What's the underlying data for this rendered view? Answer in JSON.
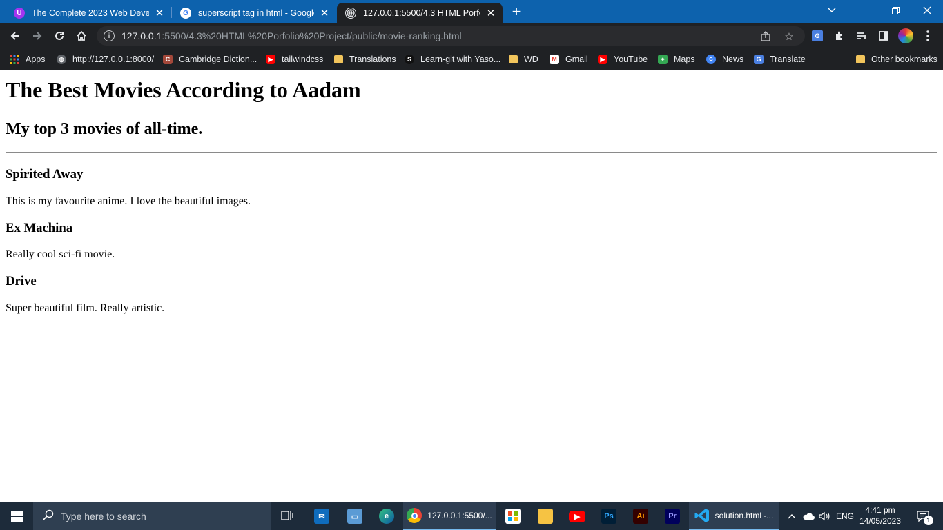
{
  "browser": {
    "tabs": [
      {
        "title": "The Complete 2023 Web Develop",
        "favicon": "udemy-icon"
      },
      {
        "title": "superscript tag in html - Google",
        "favicon": "google-icon"
      },
      {
        "title": "127.0.0.1:5500/4.3 HTML Porfolio",
        "favicon": "globe-icon"
      }
    ],
    "url_host": "127.0.0.1",
    "url_path": ":5500/4.3%20HTML%20Porfolio%20Project/public/movie-ranking.html",
    "bookmarks": [
      {
        "label": "Apps",
        "icon": "apps-grid-icon"
      },
      {
        "label": "http://127.0.0.1:8000/",
        "icon": "globe-icon"
      },
      {
        "label": "Cambridge Diction...",
        "icon": "cambridge-icon"
      },
      {
        "label": "tailwindcss",
        "icon": "youtube-icon"
      },
      {
        "label": "Translations",
        "icon": "folder-icon"
      },
      {
        "label": "Learn-git with Yaso...",
        "icon": "s-icon"
      },
      {
        "label": "WD",
        "icon": "folder-icon"
      },
      {
        "label": "Gmail",
        "icon": "gmail-icon"
      },
      {
        "label": "YouTube",
        "icon": "youtube-icon"
      },
      {
        "label": "Maps",
        "icon": "maps-icon"
      },
      {
        "label": "News",
        "icon": "news-icon"
      },
      {
        "label": "Translate",
        "icon": "translate-icon"
      }
    ],
    "other_bookmarks": "Other bookmarks"
  },
  "page": {
    "title": "The Best Movies According to Aadam",
    "subtitle": "My top 3 movies of all-time.",
    "movies": [
      {
        "name": "Spirited Away",
        "description": "This is my favourite anime. I love the beautiful images."
      },
      {
        "name": "Ex Machina",
        "description": "Really cool sci-fi movie."
      },
      {
        "name": "Drive",
        "description": "Super beautiful film. Really artistic."
      }
    ]
  },
  "taskbar": {
    "search_placeholder": "Type here to search",
    "chrome_label": "127.0.0.1:5500/...",
    "vscode_label": "solution.html -...",
    "language": "ENG",
    "time": "4:41 pm",
    "date": "14/05/2023",
    "notification_count": "1"
  },
  "colors": {
    "tabstrip": "#0d62ad",
    "toolbar": "#1f2124",
    "taskbar": "#1d2b3a"
  }
}
